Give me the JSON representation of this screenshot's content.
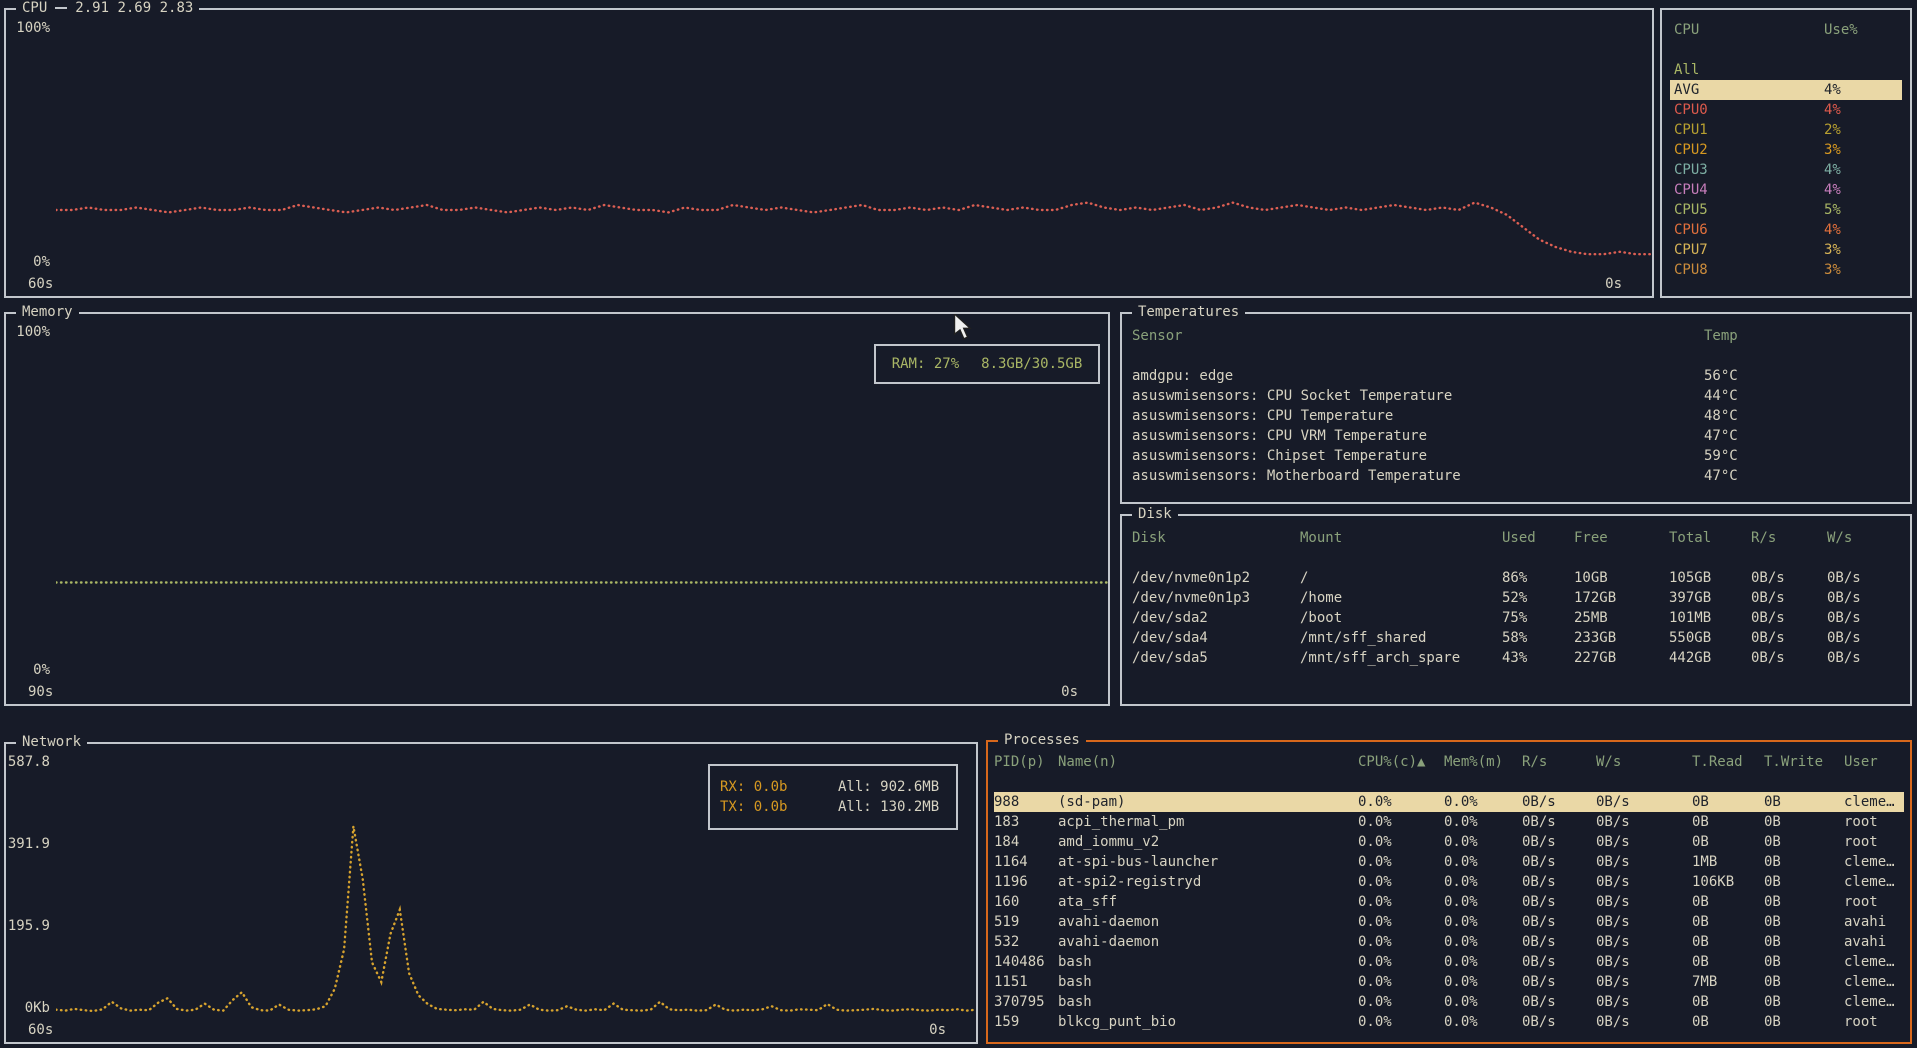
{
  "theme": {
    "bg": "#171b28",
    "border": "#c2c6cc",
    "text": "#d7d3c2",
    "header": "#8aa17b",
    "green": "#a9b665",
    "yellow": "#d79921",
    "hl-bg": "#ead8a6",
    "hl-text": "#20242c",
    "accent-orange": "#d8681c"
  },
  "cpu_panel": {
    "title": "CPU",
    "load_avg": "2.91 2.69 2.83",
    "y_top": "100%",
    "y_bottom": "0%",
    "x_left": "60s",
    "x_right": "0s",
    "line_color": "#dd5f53",
    "series": [
      24,
      24,
      25,
      24,
      24,
      25,
      24,
      23,
      24,
      25,
      24,
      24,
      25,
      24,
      24,
      26,
      25,
      24,
      23,
      24,
      25,
      24,
      25,
      26,
      24,
      24,
      25,
      24,
      23,
      24,
      25,
      24,
      25,
      24,
      26,
      25,
      24,
      24,
      23,
      25,
      24,
      24,
      26,
      25,
      24,
      25,
      24,
      23,
      24,
      25,
      26,
      24,
      24,
      25,
      24,
      25,
      24,
      26,
      25,
      24,
      25,
      24,
      24,
      26,
      27,
      25,
      24,
      25,
      24,
      25,
      26,
      24,
      25,
      27,
      25,
      24,
      25,
      26,
      25,
      24,
      25,
      24,
      25,
      26,
      25,
      24,
      25,
      24,
      27,
      25,
      22,
      17,
      12,
      9,
      7,
      6,
      6,
      7,
      6,
      6
    ]
  },
  "cpu_legend": {
    "col_cpu": "CPU",
    "col_use": "Use%",
    "all_label": "All",
    "rows": [
      {
        "name": "AVG",
        "use": "4%",
        "highlight": true
      },
      {
        "name": "CPU0",
        "use": "4%",
        "color": "#dd5a4c"
      },
      {
        "name": "CPU1",
        "use": "2%",
        "color": "#b8a030"
      },
      {
        "name": "CPU2",
        "use": "3%",
        "color": "#d79921"
      },
      {
        "name": "CPU3",
        "use": "4%",
        "color": "#7daea3"
      },
      {
        "name": "CPU4",
        "use": "4%",
        "color": "#c77dbb"
      },
      {
        "name": "CPU5",
        "use": "5%",
        "color": "#a9b665"
      },
      {
        "name": "CPU6",
        "use": "4%",
        "color": "#e2703c"
      },
      {
        "name": "CPU7",
        "use": "3%",
        "color": "#d8b456"
      },
      {
        "name": "CPU8",
        "use": "3%",
        "color": "#cc8c3c"
      }
    ]
  },
  "memory_panel": {
    "title": "Memory",
    "y_top": "100%",
    "y_bottom": "0%",
    "x_left": "90s",
    "x_right": "0s",
    "line_color": "#a9b665",
    "legend_label": "RAM: 27%",
    "legend_value": "8.3GB/30.5GB",
    "series": [
      27,
      27,
      27,
      27,
      27,
      27,
      27,
      27,
      27,
      27,
      27,
      27,
      27,
      27,
      27,
      27,
      27,
      27,
      27,
      27,
      27
    ]
  },
  "temps_panel": {
    "title": "Temperatures",
    "col_sensor": "Sensor",
    "col_temp": "Temp",
    "rows": [
      {
        "sensor": "amdgpu: edge",
        "temp": "56°C"
      },
      {
        "sensor": "asuswmisensors: CPU Socket Temperature",
        "temp": "44°C"
      },
      {
        "sensor": "asuswmisensors: CPU Temperature",
        "temp": "48°C"
      },
      {
        "sensor": "asuswmisensors: CPU VRM Temperature",
        "temp": "47°C"
      },
      {
        "sensor": "asuswmisensors: Chipset Temperature",
        "temp": "59°C"
      },
      {
        "sensor": "asuswmisensors: Motherboard Temperature",
        "temp": "47°C"
      }
    ]
  },
  "disk_panel": {
    "title": "Disk",
    "headers": [
      "Disk",
      "Mount",
      "Used",
      "Free",
      "Total",
      "R/s",
      "W/s"
    ],
    "rows": [
      {
        "disk": "/dev/nvme0n1p2",
        "mount": "/",
        "used": "86%",
        "free": "10GB",
        "total": "105GB",
        "rs": "0B/s",
        "ws": "0B/s"
      },
      {
        "disk": "/dev/nvme0n1p3",
        "mount": "/home",
        "used": "52%",
        "free": "172GB",
        "total": "397GB",
        "rs": "0B/s",
        "ws": "0B/s"
      },
      {
        "disk": "/dev/sda2",
        "mount": "/boot",
        "used": "75%",
        "free": "25MB",
        "total": "101MB",
        "rs": "0B/s",
        "ws": "0B/s"
      },
      {
        "disk": "/dev/sda4",
        "mount": "/mnt/sff_shared",
        "used": "58%",
        "free": "233GB",
        "total": "550GB",
        "rs": "0B/s",
        "ws": "0B/s"
      },
      {
        "disk": "/dev/sda5",
        "mount": "/mnt/sff_arch_spare",
        "used": "43%",
        "free": "227GB",
        "total": "442GB",
        "rs": "0B/s",
        "ws": "0B/s"
      }
    ]
  },
  "network_panel": {
    "title": "Network",
    "y_labels": [
      "587.8",
      "391.9",
      "195.9",
      "0Kb"
    ],
    "x_left": "60s",
    "x_right": "0s",
    "line_color": "#d7a32e",
    "max": 587.8,
    "rx_label": "RX: 0.0b",
    "rx_all": "All: 902.6MB",
    "tx_label": "TX: 0.0b",
    "tx_all": "All: 130.2MB",
    "series": [
      12,
      10,
      14,
      11,
      9,
      13,
      30,
      15,
      10,
      12,
      11,
      28,
      38,
      14,
      10,
      12,
      26,
      12,
      10,
      34,
      52,
      18,
      11,
      10,
      24,
      12,
      10,
      11,
      13,
      20,
      60,
      150,
      430,
      310,
      120,
      75,
      185,
      240,
      95,
      45,
      25,
      14,
      12,
      11,
      13,
      12,
      30,
      14,
      11,
      10,
      12,
      24,
      12,
      10,
      11,
      20,
      12,
      10,
      13,
      11,
      26,
      12,
      11,
      10,
      12,
      30,
      13,
      11,
      12,
      10,
      11,
      24,
      12,
      10,
      12,
      11,
      13,
      20,
      11,
      10,
      13,
      12,
      11,
      25,
      12,
      10,
      11,
      12,
      14,
      11,
      10,
      12,
      13,
      11,
      10,
      12,
      11,
      13,
      10,
      12
    ]
  },
  "processes_panel": {
    "title": "Processes",
    "headers": [
      "PID(p)",
      "Name(n)",
      "CPU%(c)▲",
      "Mem%(m)",
      "R/s",
      "W/s",
      "T.Read",
      "T.Write",
      "User"
    ],
    "rows": [
      {
        "pid": "988",
        "name": "(sd-pam)",
        "cpu": "0.0%",
        "mem": "0.0%",
        "rs": "0B/s",
        "ws": "0B/s",
        "tread": "0B",
        "twrite": "0B",
        "user": "cleme…",
        "highlight": true
      },
      {
        "pid": "183",
        "name": "acpi_thermal_pm",
        "cpu": "0.0%",
        "mem": "0.0%",
        "rs": "0B/s",
        "ws": "0B/s",
        "tread": "0B",
        "twrite": "0B",
        "user": "root"
      },
      {
        "pid": "184",
        "name": "amd_iommu_v2",
        "cpu": "0.0%",
        "mem": "0.0%",
        "rs": "0B/s",
        "ws": "0B/s",
        "tread": "0B",
        "twrite": "0B",
        "user": "root"
      },
      {
        "pid": "1164",
        "name": "at-spi-bus-launcher",
        "cpu": "0.0%",
        "mem": "0.0%",
        "rs": "0B/s",
        "ws": "0B/s",
        "tread": "1MB",
        "twrite": "0B",
        "user": "cleme…"
      },
      {
        "pid": "1196",
        "name": "at-spi2-registryd",
        "cpu": "0.0%",
        "mem": "0.0%",
        "rs": "0B/s",
        "ws": "0B/s",
        "tread": "106KB",
        "twrite": "0B",
        "user": "cleme…"
      },
      {
        "pid": "160",
        "name": "ata_sff",
        "cpu": "0.0%",
        "mem": "0.0%",
        "rs": "0B/s",
        "ws": "0B/s",
        "tread": "0B",
        "twrite": "0B",
        "user": "root"
      },
      {
        "pid": "519",
        "name": "avahi-daemon",
        "cpu": "0.0%",
        "mem": "0.0%",
        "rs": "0B/s",
        "ws": "0B/s",
        "tread": "0B",
        "twrite": "0B",
        "user": "avahi"
      },
      {
        "pid": "532",
        "name": "avahi-daemon",
        "cpu": "0.0%",
        "mem": "0.0%",
        "rs": "0B/s",
        "ws": "0B/s",
        "tread": "0B",
        "twrite": "0B",
        "user": "avahi"
      },
      {
        "pid": "140486",
        "name": "bash",
        "cpu": "0.0%",
        "mem": "0.0%",
        "rs": "0B/s",
        "ws": "0B/s",
        "tread": "0B",
        "twrite": "0B",
        "user": "cleme…"
      },
      {
        "pid": "1151",
        "name": "bash",
        "cpu": "0.0%",
        "mem": "0.0%",
        "rs": "0B/s",
        "ws": "0B/s",
        "tread": "7MB",
        "twrite": "0B",
        "user": "cleme…"
      },
      {
        "pid": "370795",
        "name": "bash",
        "cpu": "0.0%",
        "mem": "0.0%",
        "rs": "0B/s",
        "ws": "0B/s",
        "tread": "0B",
        "twrite": "0B",
        "user": "cleme…"
      },
      {
        "pid": "159",
        "name": "blkcg_punt_bio",
        "cpu": "0.0%",
        "mem": "0.0%",
        "rs": "0B/s",
        "ws": "0B/s",
        "tread": "0B",
        "twrite": "0B",
        "user": "root"
      }
    ]
  }
}
